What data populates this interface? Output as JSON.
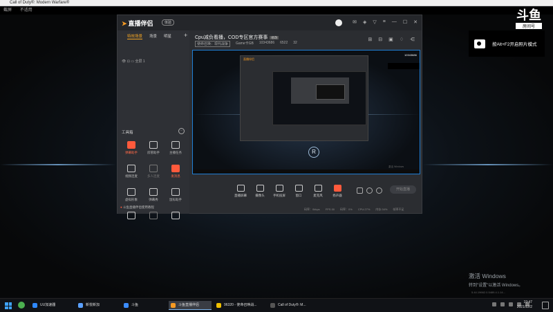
{
  "outer_window": {
    "title": "Call of Duty®: Modern Warfare®",
    "menu": [
      "截屏",
      "不适用"
    ]
  },
  "room": {
    "logo": "斗鱼",
    "label": "房间号",
    "number": "10343686"
  },
  "screenshot_tip": "按Alt+F2开启照片模式",
  "app": {
    "logo": "直播伴侣",
    "badge": "体验",
    "left_tabs": [
      "特效场景",
      "场景",
      "明星",
      "+"
    ],
    "scene_row": "全屏 1",
    "tools_title": "工具箱",
    "tools": [
      {
        "label": "弹幕助手",
        "state": "red"
      },
      {
        "label": "房管助手",
        "state": "normal"
      },
      {
        "label": "主播任务",
        "state": "normal"
      },
      {
        "label": "视频连麦",
        "state": "normal"
      },
      {
        "label": "多人连麦",
        "state": "dim"
      },
      {
        "label": "发消息",
        "state": "red"
      },
      {
        "label": "虚拟形象",
        "state": "normal"
      },
      {
        "label": "弹幕秀",
        "state": "normal"
      },
      {
        "label": "鼠标助手",
        "state": "normal"
      },
      {
        "label": "",
        "state": "normal"
      },
      {
        "label": "",
        "state": "dim"
      },
      {
        "label": "",
        "state": "normal"
      }
    ],
    "left_footer": "斗鱼直播伴侣使用教程",
    "stream_title": "Cpu减负看播，COD专区官方赛事",
    "stream_tag": "修改",
    "meta": {
      "category": "使命召唤：现代战争",
      "extra": "Game卡GB",
      "room_num": "10343686",
      "hot": "6522",
      "viewers": "32"
    },
    "preview": {
      "window_label": "激活 Windows",
      "nested_title": "直播伴侣",
      "nested_room": "10343686"
    },
    "bottom_tools": [
      {
        "label": "直播屏幕"
      },
      {
        "label": "摄像头"
      },
      {
        "label": "手机投屏"
      },
      {
        "label": "窗口"
      },
      {
        "label": "麦克风"
      },
      {
        "label": "扬声器",
        "state": "red"
      }
    ],
    "start_button": "开始直播",
    "status": [
      "码率：0kbps",
      "FPS:30",
      "码率：0%",
      "CPU:27%",
      "内存:34%",
      "帧率不足"
    ]
  },
  "watermark": {
    "line1": "激活 Windows",
    "line2": "转到\"设置\"以激活 Windows。"
  },
  "build": "5.44.19662.0.5489.4.1.14…",
  "taskbar": {
    "items": [
      {
        "label": "UU加速器",
        "color": "#2e88ff"
      },
      {
        "label": "新悦新加",
        "color": "#5aa0ff"
      },
      {
        "label": "斗鱼",
        "color": "#3b8cff"
      },
      {
        "label": "斗鱼直播伴侣",
        "color": "#f59a23",
        "active": true
      },
      {
        "label": "96320 - 使命召唤战...",
        "color": "#f0c000"
      },
      {
        "label": "Call of Duty®: M...",
        "color": "#555"
      }
    ],
    "time": "19:47",
    "date": "2021/12/2"
  }
}
